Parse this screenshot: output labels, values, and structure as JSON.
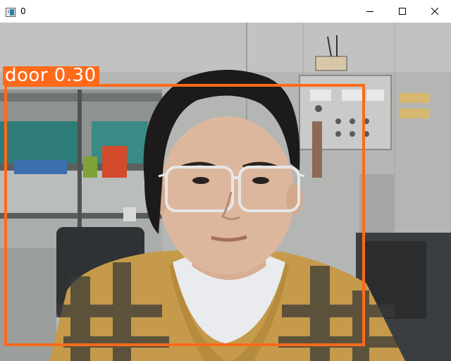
{
  "window": {
    "title": "0",
    "icon": "window-app-icon",
    "controls": {
      "minimize": "minimize-icon",
      "maximize": "maximize-icon",
      "close": "close-icon"
    }
  },
  "detection": {
    "label": "door 0.30",
    "class": "door",
    "confidence": 0.3,
    "color": "#ff6a1a"
  }
}
